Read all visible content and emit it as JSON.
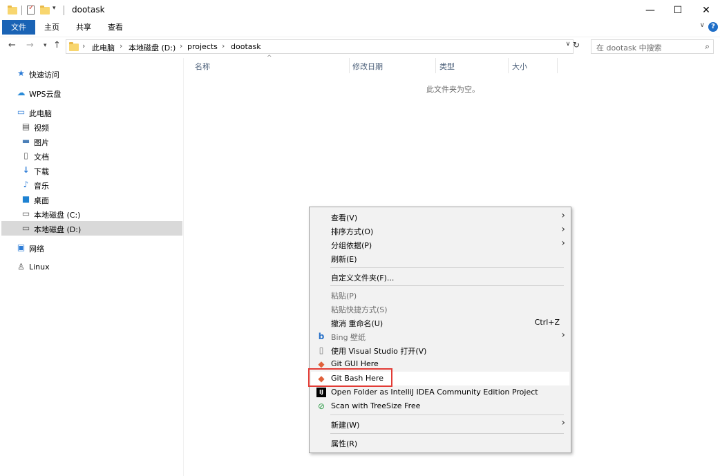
{
  "window": {
    "title": "dootask",
    "minimize": "—",
    "maximize": "☐",
    "close": "✕"
  },
  "ribbon": {
    "tabs": [
      "文件",
      "主页",
      "共享",
      "查看"
    ],
    "help": "?",
    "expand": "∨"
  },
  "address": {
    "crumbs": [
      "此电脑",
      "本地磁盘 (D:)",
      "projects",
      "dootask"
    ],
    "separator": "›",
    "search_placeholder": "在 dootask 中搜索"
  },
  "sidebar": {
    "items": [
      {
        "label": "快速访问",
        "icon": "star-icon"
      },
      {
        "label": "WPS云盘",
        "icon": "cloud-icon"
      },
      {
        "label": "此电脑",
        "icon": "computer-icon"
      },
      {
        "label": "视频",
        "icon": "video-icon"
      },
      {
        "label": "图片",
        "icon": "picture-icon"
      },
      {
        "label": "文档",
        "icon": "document-icon"
      },
      {
        "label": "下载",
        "icon": "download-icon"
      },
      {
        "label": "音乐",
        "icon": "music-icon"
      },
      {
        "label": "桌面",
        "icon": "desktop-icon"
      },
      {
        "label": "本地磁盘 (C:)",
        "icon": "drive-c-icon"
      },
      {
        "label": "本地磁盘 (D:)",
        "icon": "drive-d-icon"
      },
      {
        "label": "网络",
        "icon": "network-icon"
      },
      {
        "label": "Linux",
        "icon": "linux-icon"
      }
    ]
  },
  "content": {
    "columns": [
      "名称",
      "修改日期",
      "类型",
      "大小"
    ],
    "empty_message": "此文件夹为空。"
  },
  "context_menu": {
    "items": [
      {
        "label": "查看(V)",
        "submenu": true
      },
      {
        "label": "排序方式(O)",
        "submenu": true
      },
      {
        "label": "分组依据(P)",
        "submenu": true
      },
      {
        "label": "刷新(E)"
      },
      {
        "label": "自定义文件夹(F)..."
      },
      {
        "label": "粘贴(P)",
        "disabled": true
      },
      {
        "label": "粘贴快捷方式(S)",
        "disabled": true
      },
      {
        "label": "撤消 重命名(U)",
        "shortcut": "Ctrl+Z"
      },
      {
        "label": "Bing 壁纸",
        "disabled": true,
        "submenu": true,
        "icon": "bing-icon"
      },
      {
        "label": "使用 Visual Studio 打开(V)",
        "icon": "file-icon"
      },
      {
        "label": "Git GUI Here",
        "icon": "git-icon"
      },
      {
        "label": "Git Bash Here",
        "icon": "git-icon",
        "highlighted": true
      },
      {
        "label": "Open Folder as IntelliJ IDEA Community Edition Project",
        "icon": "intellij-icon"
      },
      {
        "label": "Scan with TreeSize Free",
        "icon": "treesize-icon"
      },
      {
        "label": "新建(W)",
        "submenu": true
      },
      {
        "label": "属性(R)"
      }
    ]
  },
  "colors": {
    "accent": "#1a63b5",
    "highlight_box": "#e23b35",
    "menu_bg": "#f2f2f2",
    "selected": "#d9d9d9"
  }
}
